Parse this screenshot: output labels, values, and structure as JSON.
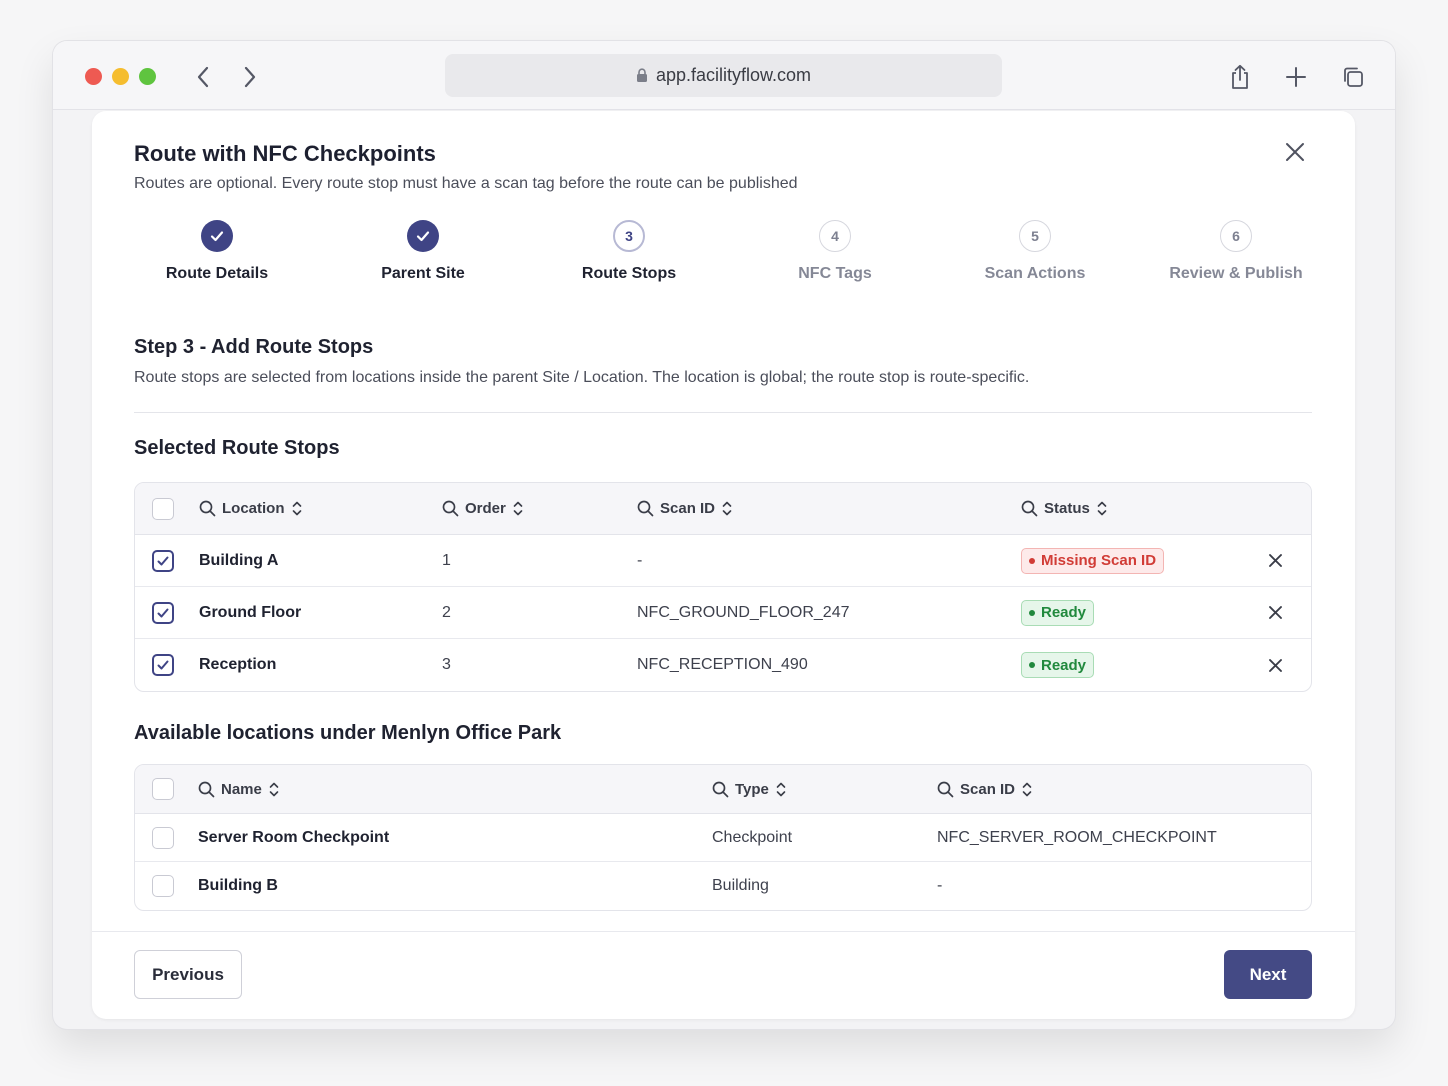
{
  "browser": {
    "url": "app.facilityflow.com"
  },
  "modal": {
    "title": "Route with NFC Checkpoints",
    "subtitle": "Routes are optional. Every route stop must have a scan tag before the route can be published"
  },
  "stepper": {
    "steps": [
      {
        "number": "1",
        "label": "Route Details",
        "state": "done"
      },
      {
        "number": "2",
        "label": "Parent Site",
        "state": "done"
      },
      {
        "number": "3",
        "label": "Route Stops",
        "state": "current"
      },
      {
        "number": "4",
        "label": "NFC Tags",
        "state": "todo"
      },
      {
        "number": "5",
        "label": "Scan Actions",
        "state": "todo"
      },
      {
        "number": "6",
        "label": "Review & Publish",
        "state": "todo"
      }
    ]
  },
  "step_section": {
    "title": "Step 3 - Add Route Stops",
    "description": "Route stops are selected from locations inside the parent Site / Location. The location is global; the route stop is route-specific."
  },
  "selected_stops": {
    "title": "Selected Route Stops",
    "columns": [
      "Location",
      "Order",
      "Scan ID",
      "Status"
    ],
    "rows": [
      {
        "location": "Building A",
        "order": "1",
        "scan_id": "-",
        "status": "Missing Scan ID",
        "status_type": "missing",
        "checked": true
      },
      {
        "location": "Ground Floor",
        "order": "2",
        "scan_id": "NFC_GROUND_FLOOR_247",
        "status": "Ready",
        "status_type": "ready",
        "checked": true
      },
      {
        "location": "Reception",
        "order": "3",
        "scan_id": "NFC_RECEPTION_490",
        "status": "Ready",
        "status_type": "ready",
        "checked": true
      }
    ]
  },
  "available": {
    "title": "Available locations under Menlyn Office Park",
    "columns": [
      "Name",
      "Type",
      "Scan ID"
    ],
    "rows": [
      {
        "name": "Server Room Checkpoint",
        "type": "Checkpoint",
        "scan_id": "NFC_SERVER_ROOM_CHECKPOINT",
        "checked": false
      },
      {
        "name": "Building B",
        "type": "Building",
        "scan_id": "-",
        "checked": false
      }
    ]
  },
  "footer": {
    "previous_label": "Previous",
    "next_label": "Next"
  },
  "colors": {
    "primary": "#3f4485",
    "danger": "#d13c36",
    "success": "#21893d"
  }
}
